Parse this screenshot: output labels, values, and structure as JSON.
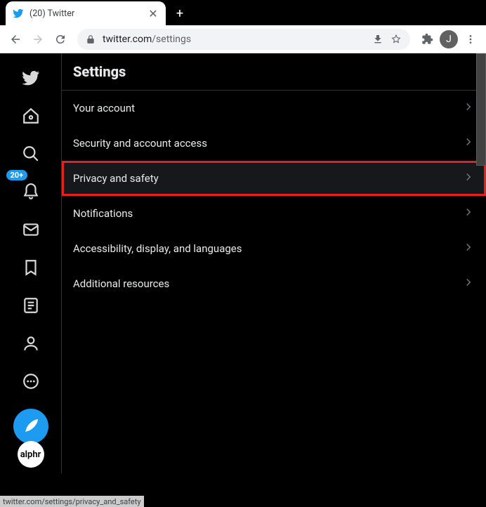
{
  "window": {
    "tab_title": "(20) Twitter",
    "url_host": "twitter.com",
    "url_path": "/settings",
    "avatar_letter": "J"
  },
  "sidebar": {
    "badge_count": "20+"
  },
  "main": {
    "title": "Settings",
    "items": [
      {
        "label": "Your account",
        "active": false,
        "highlighted": false
      },
      {
        "label": "Security and account access",
        "active": false,
        "highlighted": false
      },
      {
        "label": "Privacy and safety",
        "active": true,
        "highlighted": true
      },
      {
        "label": "Notifications",
        "active": false,
        "highlighted": false
      },
      {
        "label": "Accessibility, display, and languages",
        "active": false,
        "highlighted": false
      },
      {
        "label": "Additional resources",
        "active": false,
        "highlighted": false
      }
    ]
  },
  "status_text": "twitter.com/settings/privacy_and_safety",
  "alphr_label": "alphr"
}
